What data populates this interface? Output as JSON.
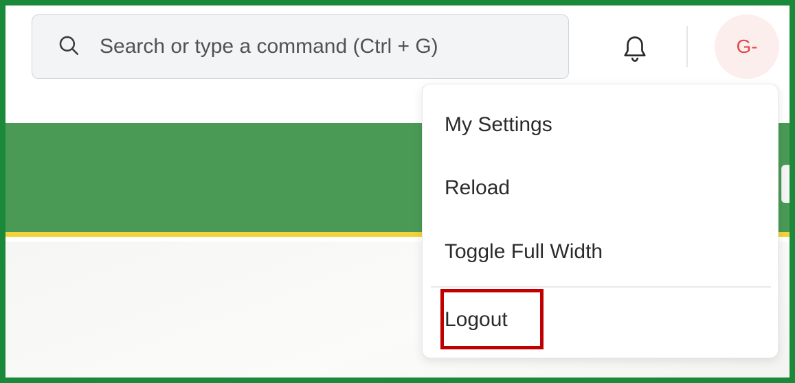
{
  "navbar": {
    "search": {
      "placeholder": "Search or type a command (Ctrl + G)",
      "icon": "search-icon"
    },
    "notifications_icon": "bell-icon",
    "avatar": {
      "initials": "G-",
      "background": "#fdeeee",
      "text_color": "#e04848"
    }
  },
  "dropdown": {
    "items": [
      {
        "label": "My Settings"
      },
      {
        "label": "Reload"
      },
      {
        "label": "Toggle Full Width"
      },
      {
        "label": "Logout"
      }
    ]
  },
  "colors": {
    "frame_border": "#1a8a3a",
    "banner": "#4a9a56",
    "banner_stripe": "#f2d33b",
    "highlight_box": "#c00000"
  }
}
